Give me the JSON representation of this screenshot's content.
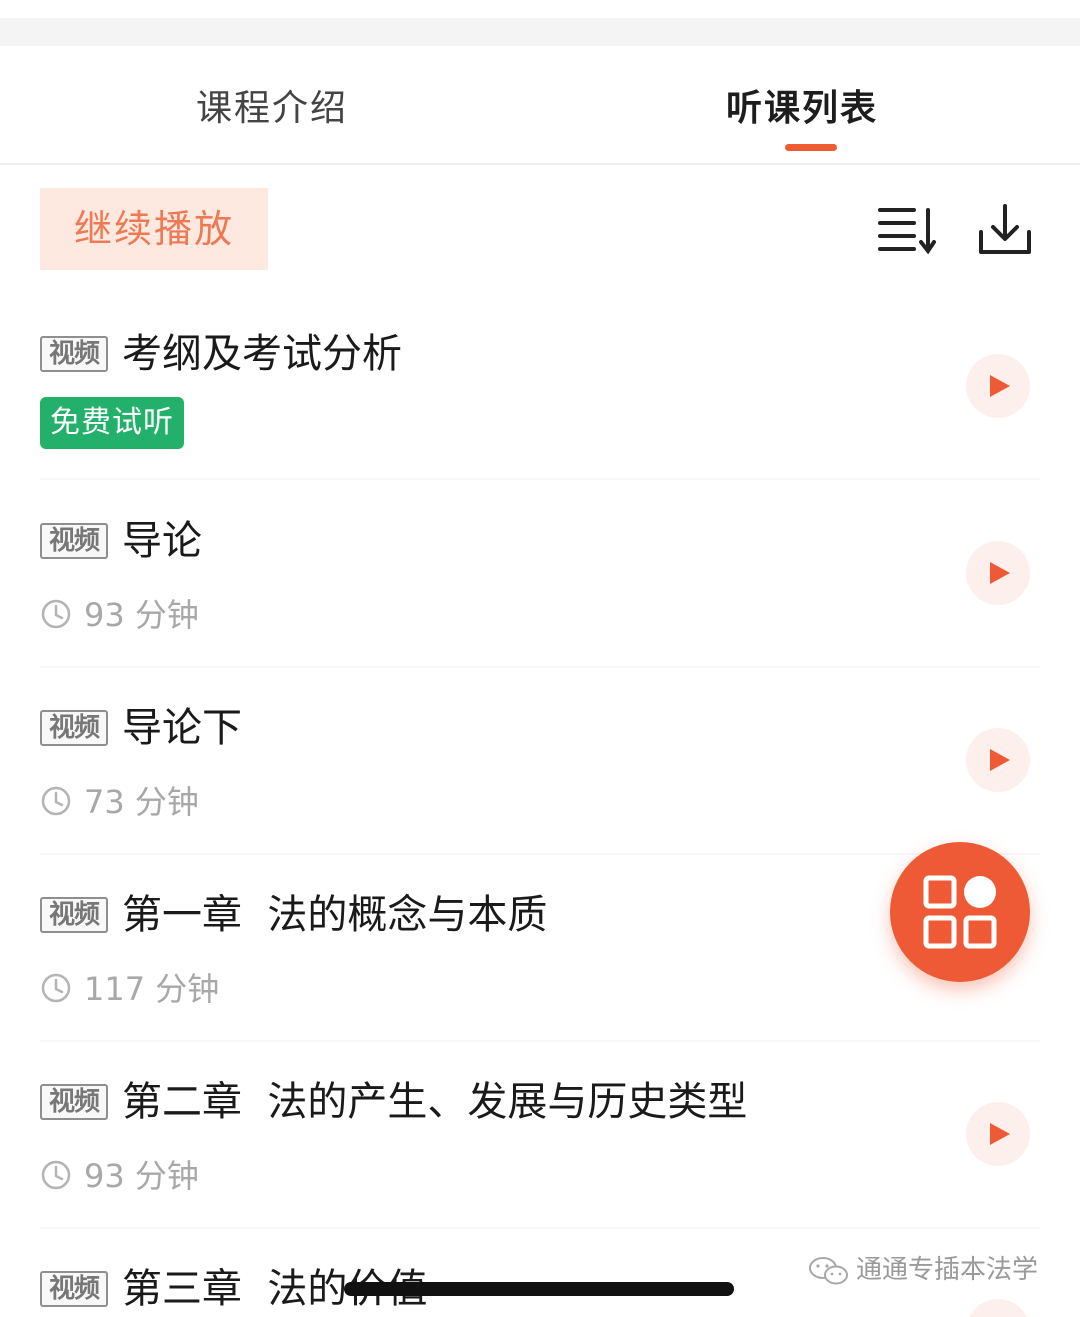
{
  "tabs": [
    {
      "label": "课程介绍",
      "active": false
    },
    {
      "label": "听课列表",
      "active": true
    }
  ],
  "accent_color": "#ef5b33",
  "free_tag_color": "#22b06a",
  "toolbar": {
    "continue_label": "继续播放",
    "sort_icon": "list-sort-icon",
    "download_icon": "download-icon"
  },
  "lessons": [
    {
      "type_badge": "视频",
      "title": "考纲及考试分析",
      "tag": "免费试听"
    },
    {
      "type_badge": "视频",
      "title": "导论",
      "duration": "93 分钟"
    },
    {
      "type_badge": "视频",
      "title": "导论下",
      "duration": "73 分钟"
    },
    {
      "type_badge": "视频",
      "title": "第一章  法的概念与本质",
      "duration": "117 分钟"
    },
    {
      "type_badge": "视频",
      "title": "第二章  法的产生、发展与历史类型",
      "duration": "93 分钟"
    },
    {
      "type_badge": "视频",
      "title": "第三章  法的价值"
    }
  ],
  "fab_icon": "apps-grid-icon",
  "watermark": "通通专插本法学"
}
